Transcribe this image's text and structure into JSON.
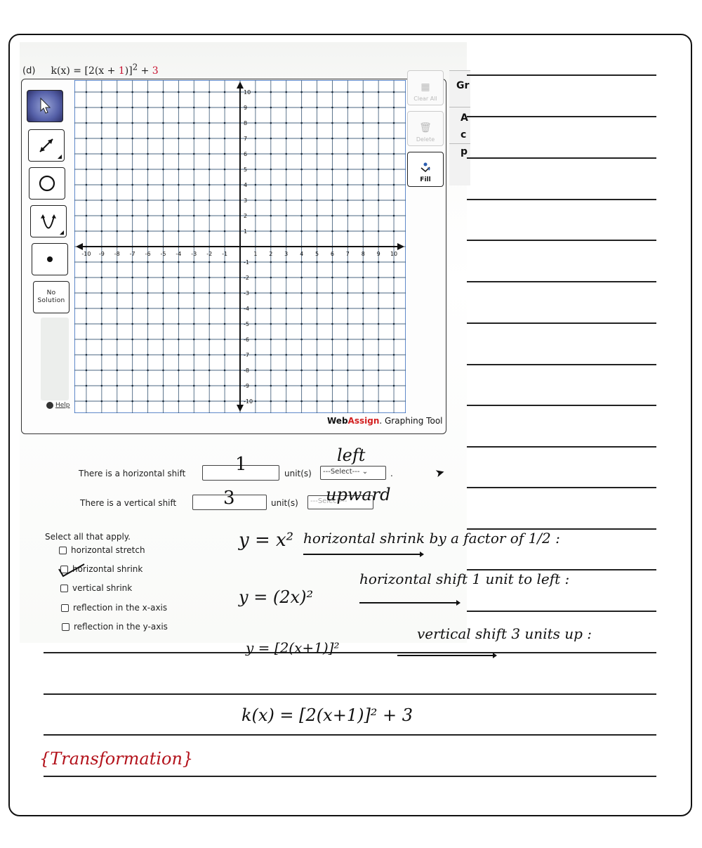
{
  "problem": {
    "label": "(d)",
    "function_lhs": "k(x) = [2(x + ",
    "shift_h": "1",
    "function_mid": ")]",
    "exponent": "2",
    "plus": " + ",
    "shift_v": "3"
  },
  "graphing_tool": {
    "left_tools": [
      {
        "name": "select-tool",
        "icon": "pointer-arrow"
      },
      {
        "name": "line-tool",
        "icon": "double-arrow-line"
      },
      {
        "name": "circle-tool",
        "icon": "circle"
      },
      {
        "name": "parabola-tool",
        "icon": "parabola"
      },
      {
        "name": "point-tool",
        "icon": "dot"
      },
      {
        "name": "no-solution-tool",
        "label": "No\nSolution"
      }
    ],
    "no_solution_line1": "No",
    "no_solution_line2": "Solution",
    "help_label": "Help",
    "right_tools": [
      {
        "label": "Clear All",
        "icon": "clear-icon",
        "enabled": false
      },
      {
        "label": "Delete",
        "icon": "trash-icon",
        "enabled": false
      },
      {
        "label": "Fill",
        "icon": "fill-bucket-icon",
        "enabled": true
      }
    ],
    "side_text": [
      "Gr",
      "A",
      "c",
      "p"
    ],
    "brand_web": "Web",
    "brand_assign": "Assign",
    "brand_rest": ". Graphing Tool",
    "axes": {
      "x_range": [
        -10,
        10
      ],
      "y_range": [
        -10,
        10
      ],
      "x_ticks": [
        -10,
        -9,
        -8,
        -7,
        -6,
        -5,
        -4,
        -3,
        -2,
        -1,
        1,
        2,
        3,
        4,
        5,
        6,
        7,
        8,
        9,
        10
      ],
      "y_ticks": [
        -10,
        -9,
        -8,
        -7,
        -6,
        -5,
        -4,
        -3,
        -2,
        -1,
        1,
        2,
        3,
        4,
        5,
        6,
        7,
        8,
        9,
        10
      ],
      "grid": true
    }
  },
  "questions": {
    "h_shift_prefix": "There is a horizontal shift",
    "h_shift_value": "1",
    "h_shift_unit": "unit(s)",
    "h_shift_select": "---Select---",
    "h_shift_handwritten": "left",
    "v_shift_prefix": "There is a vertical shift",
    "v_shift_value": "3",
    "v_shift_unit": "unit(s)",
    "v_shift_select": "---Select---",
    "v_shift_handwritten": "upward",
    "period": "."
  },
  "select_all": {
    "prompt": "Select all that apply.",
    "options": [
      {
        "label": "horizontal stretch",
        "checked": false
      },
      {
        "label": "horizontal shrink",
        "checked": true
      },
      {
        "label": "vertical shrink",
        "checked": false
      },
      {
        "label": "reflection in the x-axis",
        "checked": false
      },
      {
        "label": "reflection in the y-axis",
        "checked": false
      }
    ]
  },
  "handwritten_solution": {
    "step1_expr": "y = x²",
    "step1_note": "horizontal shrink by a factor of 1/2 :",
    "step2_expr": "y = (2x)²",
    "step2_note": "horizontal shift 1 unit to left :",
    "step3_expr": "y = [2(x+1)]²",
    "step3_note": "vertical shift 3 units up :",
    "result": "k(x) = [2(x+1)]² + 3",
    "tag": "{Transformation}"
  }
}
